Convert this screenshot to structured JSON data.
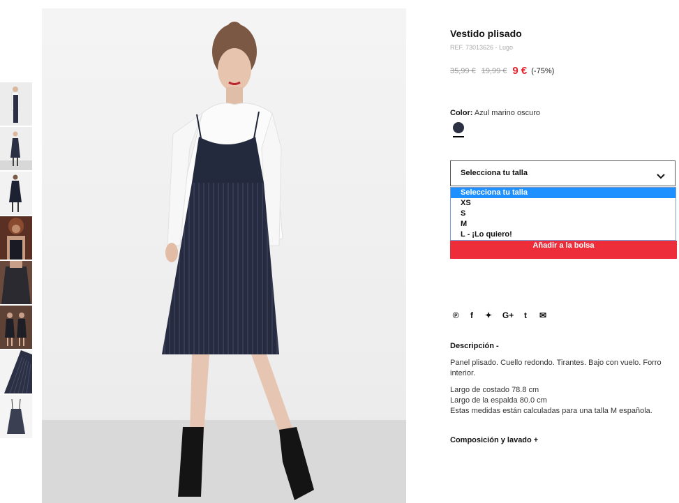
{
  "product": {
    "title": "Vestido plisado",
    "ref": "REF. 73013626 - Lugo",
    "price_original": "35,99 €",
    "price_previous": "19,99 €",
    "price_current": "9 €",
    "discount": "(-75%)",
    "color_label": "Color:",
    "color_value": "Azul marino oscuro",
    "swatch_color": "#2c3143"
  },
  "size_select": {
    "label": "Selecciona tu talla",
    "options": [
      "Selecciona tu talla",
      "XS",
      "S",
      "M",
      "L - ¡Lo quiero!"
    ],
    "highlighted_option": "Selecciona tu talla"
  },
  "add_to_bag": "Añadir a la bolsa",
  "share_icons": [
    "pinterest-icon",
    "facebook-icon",
    "twitter-icon",
    "google-plus-icon",
    "tumblr-icon",
    "email-icon"
  ],
  "share_glyphs": [
    "℗",
    "f",
    "✦",
    "G+",
    "t",
    "✉"
  ],
  "description": {
    "heading": "Descripción -",
    "lines": [
      "Panel plisado. Cuello redondo. Tirantes. Bajo con vuelo. Forro",
      "interior."
    ],
    "measures": [
      "Largo de costado 78.8 cm",
      "Largo de la espalda 80.0 cm",
      "Estas medidas están calculadas para una talla M española."
    ]
  },
  "composition_heading": "Composición y lavado +",
  "colors": {
    "accent_red": "#ee2d3a",
    "price_red": "#e8232d",
    "highlight_blue": "#1e90ff"
  }
}
